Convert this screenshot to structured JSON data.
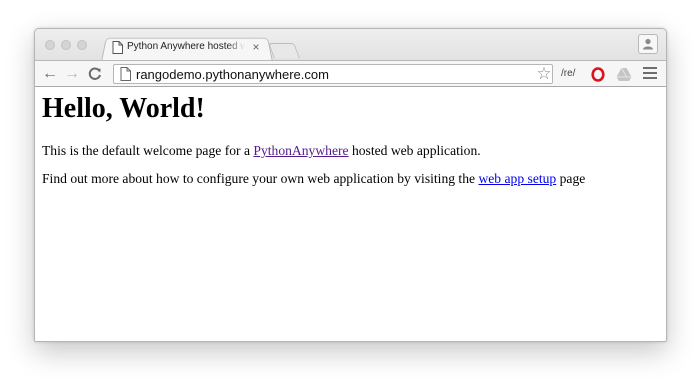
{
  "browser": {
    "tab": {
      "title": "Python Anywhere hosted w",
      "close_glyph": "×",
      "icon": "document-icon"
    },
    "toolbar": {
      "back_glyph": "←",
      "forward_glyph": "→",
      "reload_glyph": "C",
      "url": "rangodemo.pythonanywhere.com",
      "bookmark_glyph": "☆",
      "extension_re_label": "/re/",
      "extension_icons": [
        "opera-icon",
        "drive-icon"
      ],
      "menu_icon": "hamburger-menu-icon"
    },
    "profile_icon": "person-icon"
  },
  "page": {
    "heading": "Hello, World!",
    "p1": {
      "before": "This is the default welcome page for a ",
      "link": "PythonAnywhere",
      "after": " hosted web application."
    },
    "p2": {
      "before": "Find out more about how to configure your own web application by visiting the ",
      "link": "web app setup",
      "after": " page"
    }
  },
  "colors": {
    "visited_link": "#551a8b",
    "link": "#0000ee",
    "opera_red": "#d8151e"
  }
}
